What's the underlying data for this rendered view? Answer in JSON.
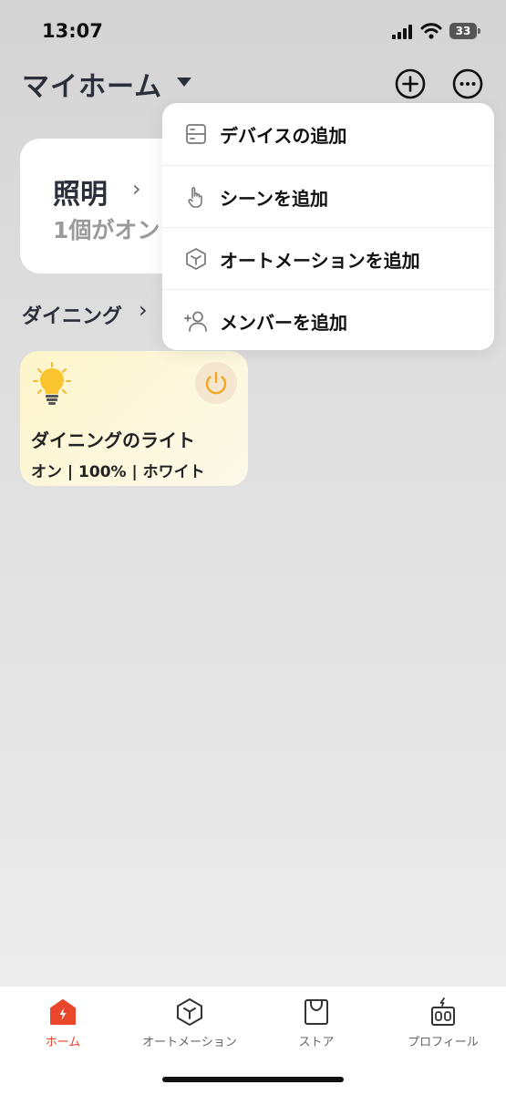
{
  "status_bar": {
    "time": "13:07",
    "battery": "33"
  },
  "header": {
    "title": "マイホーム"
  },
  "lighting_card": {
    "title": "照明",
    "subtitle": "1個がオン"
  },
  "room": {
    "title": "ダイニング"
  },
  "device": {
    "name": "ダイニングのライト",
    "status": "オン | 100% | ホワイト",
    "power": "on"
  },
  "menu": {
    "items": [
      {
        "label": "デバイスの追加",
        "icon": "device-icon"
      },
      {
        "label": "シーンを追加",
        "icon": "tap-hand-icon"
      },
      {
        "label": "オートメーションを追加",
        "icon": "cube-icon"
      },
      {
        "label": "メンバーを追加",
        "icon": "add-person-icon"
      }
    ]
  },
  "bottom_nav": {
    "items": [
      {
        "label": "ホーム",
        "icon": "home-icon",
        "active": true
      },
      {
        "label": "オートメーション",
        "icon": "automation-icon",
        "active": false
      },
      {
        "label": "ストア",
        "icon": "store-bag-icon",
        "active": false
      },
      {
        "label": "プロフィール",
        "icon": "profile-icon",
        "active": false
      }
    ]
  },
  "colors": {
    "accent": "#e9462c",
    "power": "#f5a623",
    "bulb": "#fbc531"
  }
}
